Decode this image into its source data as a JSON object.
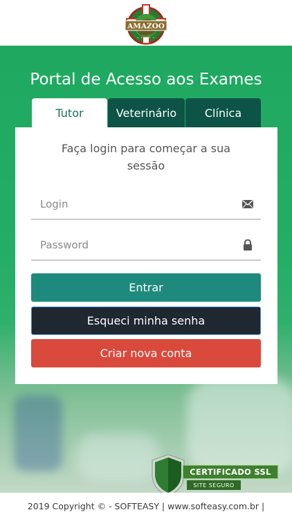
{
  "header": {
    "logo_text": "AMAZOO"
  },
  "portal": {
    "title": "Portal de Acesso aos Exames"
  },
  "tabs": [
    {
      "label": "Tutor",
      "active": true
    },
    {
      "label": "Veterinário",
      "active": false
    },
    {
      "label": "Clínica",
      "active": false
    }
  ],
  "login_form": {
    "intro_line1": "Faça login para começar a sua",
    "intro_line2": "sessão",
    "login_placeholder": "Login",
    "password_placeholder": "Password",
    "login_icon": "envelope-icon",
    "password_icon": "lock-icon",
    "entrar_label": "Entrar",
    "esqueci_label": "Esqueci minha senha",
    "criar_label": "Criar nova conta"
  },
  "ssl_badge": {
    "title": "CERTIFICADO SSL",
    "subtitle": "SITE SEGURO"
  },
  "footer": {
    "text": "2019 Copyright © - SOFTEASY | www.softeasy.com.br |"
  },
  "colors": {
    "brand_green": "#1ea860",
    "tab_dark": "#0d5447",
    "entrar": "#1e8a7e",
    "esqueci": "#1f2730",
    "criar": "#d94a3c"
  }
}
